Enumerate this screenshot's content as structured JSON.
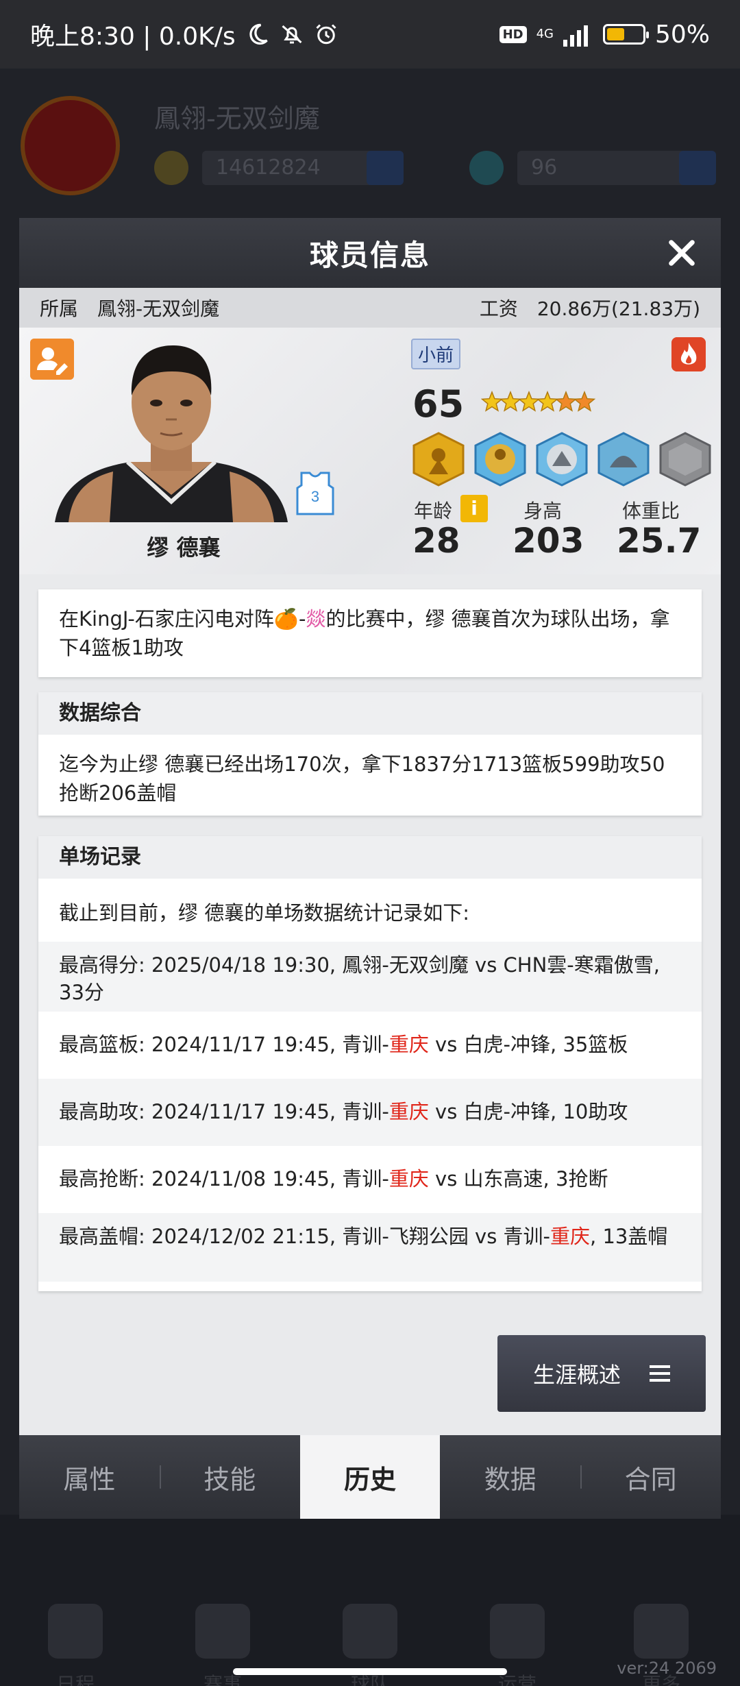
{
  "status_bar": {
    "time_speed": "晚上8:30 | 0.0K/s",
    "hd": "HD",
    "network": "4G",
    "battery_level": 0.5,
    "battery": "50%"
  },
  "background": {
    "team_name": "鳳翎-无双剑魔",
    "coins": "14612824",
    "gems": "96"
  },
  "modal": {
    "title": "球员信息",
    "club_label": "所属",
    "club_name": "鳳翎-无双剑魔",
    "salary_label": "工资",
    "salary_value": "20.86万(21.83万)"
  },
  "player": {
    "name": "缪 德襄",
    "jersey_number": "3",
    "position": "小前",
    "overall": "65",
    "star_rating": 6,
    "age_label": "年龄",
    "age": "28",
    "height_label": "身高",
    "height": "203",
    "bmi_label": "体重比",
    "bmi": "25.7",
    "info_icon": "i"
  },
  "history": {
    "debut_before": "在KingJ-石家庄闪电对阵🍊-",
    "debut_pink": "燚",
    "debut_after": "的比赛中，缪 德襄首次为球队出场，拿下4篮板1助攻",
    "summary_title": "数据综合",
    "summary_text": "迄今为止缪 德襄已经出场170次，拿下1837分1713篮板599助攻50抢断206盖帽",
    "records_title": "单场记录",
    "records_intro": "截止到目前，缪 德襄的单场数据统计记录如下:",
    "records": [
      {
        "before": "最高得分: 2025/04/18 19:30, 鳳翎-无双剑魔 vs CHN雲-寒霜傲雪, 33分",
        "red": "",
        "after": ""
      },
      {
        "before": "最高篮板: 2024/11/17 19:45, 青训-",
        "red": "重庆",
        "after": " vs 白虎-冲锋, 35篮板"
      },
      {
        "before": "最高助攻: 2024/11/17 19:45, 青训-",
        "red": "重庆",
        "after": " vs 白虎-冲锋, 10助攻"
      },
      {
        "before": "最高抢断: 2024/11/08 19:45, 青训-",
        "red": "重庆",
        "after": " vs 山东高速, 3抢断"
      },
      {
        "before": "最高盖帽: 2024/12/02 21:15, 青训-飞翔公园 vs 青训-",
        "red": "重庆",
        "after": ", 13盖帽"
      }
    ]
  },
  "career_button": "生涯概述",
  "tabs": [
    "属性",
    "技能",
    "历史",
    "数据",
    "合同"
  ],
  "active_tab": "历史",
  "dock": [
    "日程",
    "赛事",
    "球队",
    "运营",
    "更多"
  ],
  "version": "ver:24  2069"
}
